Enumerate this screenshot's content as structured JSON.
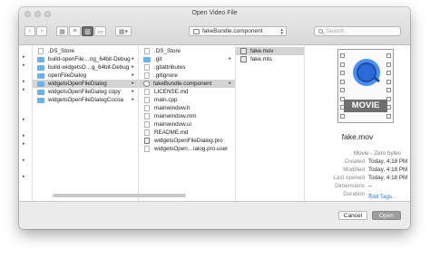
{
  "window": {
    "title": "Open Video File"
  },
  "toolbar": {
    "back_icon": "chevron-left-icon",
    "forward_icon": "chevron-right-icon",
    "view_modes": [
      "icon-view",
      "list-view",
      "column-view",
      "cover-flow-view"
    ],
    "arrange_icon": "arrange-grid-icon",
    "location": "fakeBundle.component",
    "search_placeholder": "Search"
  },
  "column1": {
    "items": [
      {
        "label": ".DS_Store",
        "type": "doc"
      },
      {
        "label": "build-openFile…ng_64bit-Debug",
        "type": "folder"
      },
      {
        "label": "build-widgetsO…g_64bit-Debug",
        "type": "folder"
      },
      {
        "label": "openFileDialog",
        "type": "folder"
      },
      {
        "label": "widgetsOpenFileDialog",
        "type": "folder",
        "selected": true
      },
      {
        "label": "widgetsOpenFileDialog copy",
        "type": "folder"
      },
      {
        "label": "widgetsOpenFileDialogCocoa",
        "type": "folder"
      }
    ]
  },
  "column2": {
    "items": [
      {
        "label": ".DS_Store",
        "type": "doc"
      },
      {
        "label": ".git",
        "type": "folder"
      },
      {
        "label": ".gitattributes",
        "type": "doc"
      },
      {
        "label": ".gitignore",
        "type": "doc"
      },
      {
        "label": "fakeBundle.component",
        "type": "plugin",
        "selected": true
      },
      {
        "label": "LICENSE.md",
        "type": "doc"
      },
      {
        "label": "main.cpp",
        "type": "doc"
      },
      {
        "label": "mainwindow.h",
        "type": "doc"
      },
      {
        "label": "mainwindow.mm",
        "type": "doc"
      },
      {
        "label": "mainwindow.ui",
        "type": "doc"
      },
      {
        "label": "README.md",
        "type": "doc"
      },
      {
        "label": "widgetsOpenFileDialog.pro",
        "type": "doc"
      },
      {
        "label": "widgetsOpen…ialog.pro.user",
        "type": "doc"
      }
    ]
  },
  "column3": {
    "items": [
      {
        "label": "fake.mov",
        "type": "movie",
        "selected": true
      },
      {
        "label": "fake.mts",
        "type": "movie"
      }
    ]
  },
  "preview": {
    "icon_label": "MOVIE",
    "name": "fake.mov",
    "kind": "Movie - Zero bytes",
    "info": [
      {
        "key": "Created",
        "value": "Today, 4:18 PM"
      },
      {
        "key": "Modified",
        "value": "Today, 4:18 PM"
      },
      {
        "key": "Last opened",
        "value": "Today, 4:18 PM"
      },
      {
        "key": "Dimensions",
        "value": "--"
      },
      {
        "key": "Duration",
        "value": "--"
      }
    ],
    "add_tags": "Add Tags..."
  },
  "footer": {
    "cancel": "Cancel",
    "open": "Open"
  }
}
